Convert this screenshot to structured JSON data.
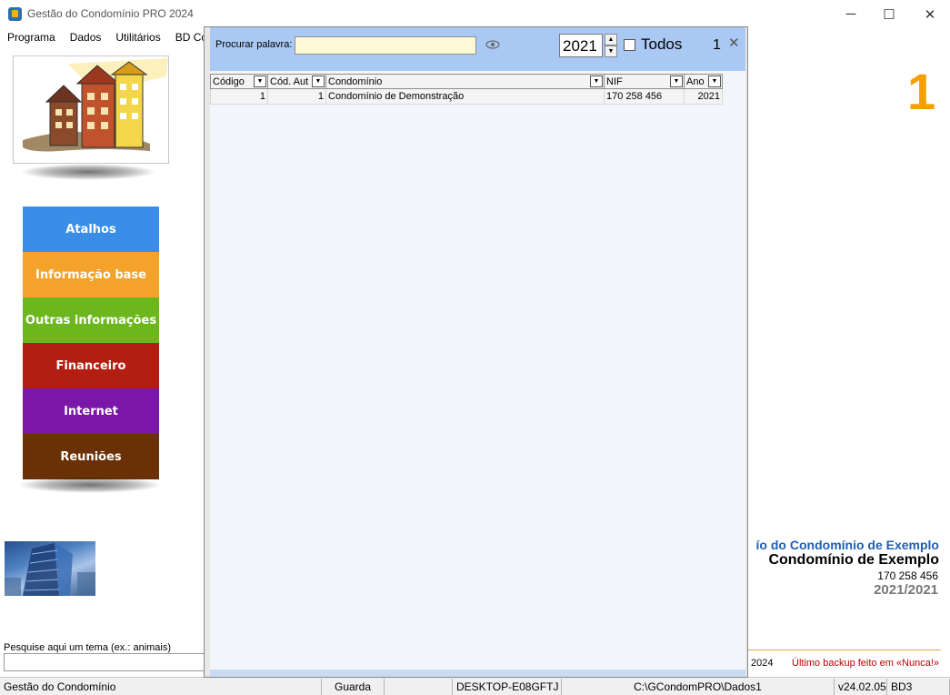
{
  "window": {
    "title": "Gestão do Condomínio PRO 2024",
    "minimize": "─",
    "maximize": "☐",
    "close": "✕"
  },
  "menu": [
    "Programa",
    "Dados",
    "Utilitários",
    "BD Con"
  ],
  "nav": {
    "atalhos": "Atalhos",
    "info": "Informação base",
    "outras": "Outras informações",
    "financeiro": "Financeiro",
    "internet": "Internet",
    "reunioes": "Reuniões"
  },
  "left": {
    "search_label": "Pesquise aqui um tema (ex.: animais)"
  },
  "right": {
    "big_number": "1",
    "line1": "ío do Condomínio de Exemplo",
    "line2": "Condomínio de Exemplo",
    "nif": "170 258 456",
    "years": "2021/2021",
    "year_text": "2024",
    "backup_text": "Último backup feito em  «Nunca!»"
  },
  "statusbar": {
    "app": "Gestão do Condomínio",
    "guarda": "Guarda",
    "host": "DESKTOP-E08GFTJ",
    "path": "C:\\GCondomPRO\\Dados1",
    "version": "v24.02.05",
    "db": "BD3"
  },
  "modal": {
    "search_label": "Procurar palavra:",
    "search_value": "",
    "year": "2021",
    "todos_label": "Todos",
    "count": "1",
    "close": "✕",
    "columns": [
      "Código",
      "Cód. Aut",
      "Condomínio",
      "NIF",
      "Ano"
    ],
    "rows": [
      {
        "codigo": "1",
        "cod_aut": "1",
        "condominio": "Condomínio de Demonstração",
        "nif": "170 258 456",
        "ano": "2021"
      }
    ]
  },
  "colors": {
    "atalhos": "#3b8ee8",
    "info": "#f4a22a",
    "outras": "#6cb71e",
    "financeiro": "#b41e10",
    "internet": "#7a16a8",
    "reunioes": "#6a3106",
    "accent_number": "#f4a000",
    "modal_header": "#a9c8f3"
  }
}
